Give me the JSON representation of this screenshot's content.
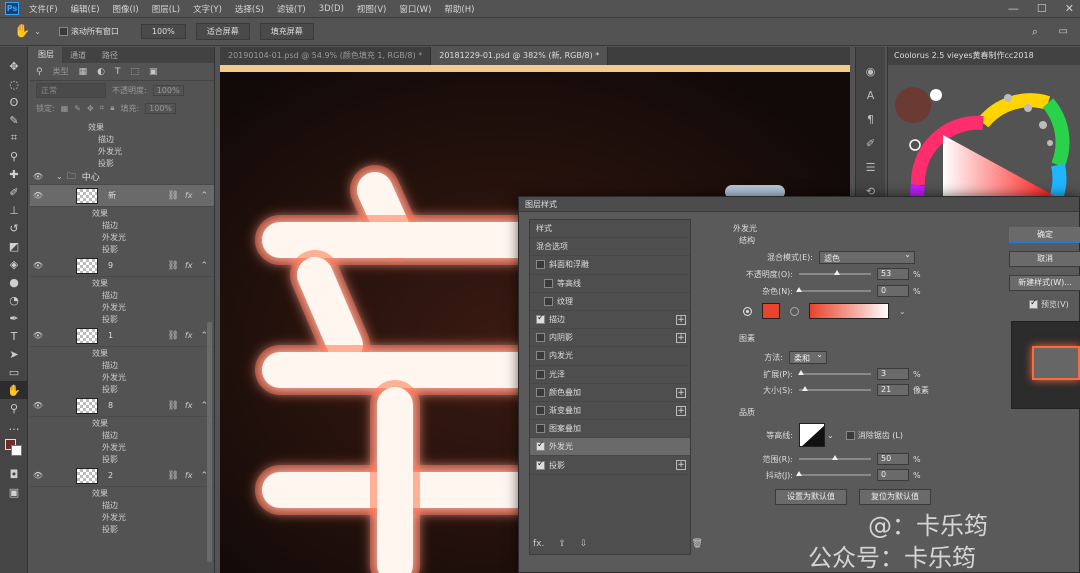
{
  "menubar": {
    "logo": "Ps",
    "items": [
      "文件(F)",
      "编辑(E)",
      "图像(I)",
      "图层(L)",
      "文字(Y)",
      "选择(S)",
      "滤镜(T)",
      "3D(D)",
      "视图(V)",
      "窗口(W)",
      "帮助(H)"
    ]
  },
  "options": {
    "scroll_all_label": "滚动所有窗口",
    "zoom_value": "100%",
    "fit_screen": "适合屏幕",
    "fill_screen": "填充屏幕"
  },
  "doc_tabs": [
    "20190104-01.psd @ 54.9% (颜色填充 1, RGB/8) *",
    "20181229-01.psd @ 382% (新, RGB/8) *"
  ],
  "layers_panel": {
    "tabs": [
      "图层",
      "通道",
      "路径"
    ],
    "filter_placeholder": "类型",
    "blend_mode": "正常",
    "opacity_label": "不透明度:",
    "opacity_value": "100%",
    "lock_label": "锁定:",
    "fill_label": "填充:",
    "fill_value": "100%",
    "top_effects": [
      "效果",
      "描边",
      "外发光",
      "投影"
    ],
    "group_name": "中心",
    "layers": [
      {
        "name": "新",
        "fx": "fx",
        "effects": [
          "效果",
          "描边",
          "外发光",
          "投影"
        ]
      },
      {
        "name": "9",
        "fx": "fx",
        "effects": [
          "效果",
          "描边",
          "外发光",
          "投影"
        ]
      },
      {
        "name": "1",
        "fx": "fx",
        "effects": [
          "效果",
          "描边",
          "外发光",
          "投影"
        ]
      },
      {
        "name": "8",
        "fx": "fx",
        "effects": [
          "效果",
          "描边",
          "外发光",
          "投影"
        ]
      },
      {
        "name": "2",
        "fx": "fx",
        "effects": [
          "效果",
          "描边",
          "外发光",
          "投影"
        ]
      }
    ]
  },
  "coolorus": {
    "title": "Coolorus 2.5 vieyes黄春制作cc2018"
  },
  "canvas": {
    "glyph": "亲"
  },
  "dialog": {
    "title": "图层样式",
    "styles": [
      {
        "label": "样式",
        "check": false,
        "has_check": false,
        "plus": false,
        "indent": false
      },
      {
        "label": "混合选项",
        "check": false,
        "has_check": false,
        "plus": false,
        "indent": false
      },
      {
        "label": "斜面和浮雕",
        "check": false,
        "has_check": true,
        "plus": false,
        "indent": false
      },
      {
        "label": "等高线",
        "check": false,
        "has_check": true,
        "plus": false,
        "indent": true
      },
      {
        "label": "纹理",
        "check": false,
        "has_check": true,
        "plus": false,
        "indent": true
      },
      {
        "label": "描边",
        "check": true,
        "has_check": true,
        "plus": true,
        "indent": false
      },
      {
        "label": "内阴影",
        "check": false,
        "has_check": true,
        "plus": true,
        "indent": false
      },
      {
        "label": "内发光",
        "check": false,
        "has_check": true,
        "plus": false,
        "indent": false
      },
      {
        "label": "光泽",
        "check": false,
        "has_check": true,
        "plus": false,
        "indent": false
      },
      {
        "label": "颜色叠加",
        "check": false,
        "has_check": true,
        "plus": true,
        "indent": false
      },
      {
        "label": "渐变叠加",
        "check": false,
        "has_check": true,
        "plus": true,
        "indent": false
      },
      {
        "label": "图案叠加",
        "check": false,
        "has_check": true,
        "plus": false,
        "indent": false
      },
      {
        "label": "外发光",
        "check": true,
        "has_check": true,
        "plus": false,
        "indent": false,
        "selected": true
      },
      {
        "label": "投影",
        "check": true,
        "has_check": true,
        "plus": true,
        "indent": false
      }
    ],
    "footer_fx": "fx.",
    "panel_title": "外发光",
    "structure": {
      "title": "结构",
      "blend_label": "混合模式(E):",
      "blend_value": "滤色",
      "opacity_label": "不透明度(O):",
      "opacity_value": "53",
      "opacity_frac": 0.53,
      "noise_label": "杂色(N):",
      "noise_value": "0",
      "noise_frac": 0,
      "unit": "%"
    },
    "elements": {
      "title": "图素",
      "method_label": "方法:",
      "method_value": "柔和",
      "spread_label": "扩展(P):",
      "spread_value": "3",
      "spread_frac": 0.03,
      "size_label": "大小(S):",
      "size_value": "21",
      "size_frac": 0.085,
      "pct": "%",
      "px": "像素"
    },
    "quality": {
      "title": "品质",
      "contour_label": "等高线:",
      "antialias_label": "消除锯齿 (L)",
      "range_label": "范围(R):",
      "range_value": "50",
      "range_frac": 0.5,
      "jitter_label": "抖动(J):",
      "jitter_value": "0",
      "jitter_frac": 0,
      "pct": "%"
    },
    "set_default": "设置为默认值",
    "reset_default": "复位为默认值",
    "buttons": {
      "ok": "确定",
      "cancel": "取消",
      "new_style": "新建样式(W)...",
      "preview": "预览(V)"
    },
    "colors": {
      "glow": "#e8432c"
    }
  },
  "watermark": {
    "line1": "@：卡乐筠",
    "line2": "公众号：卡乐筠"
  }
}
